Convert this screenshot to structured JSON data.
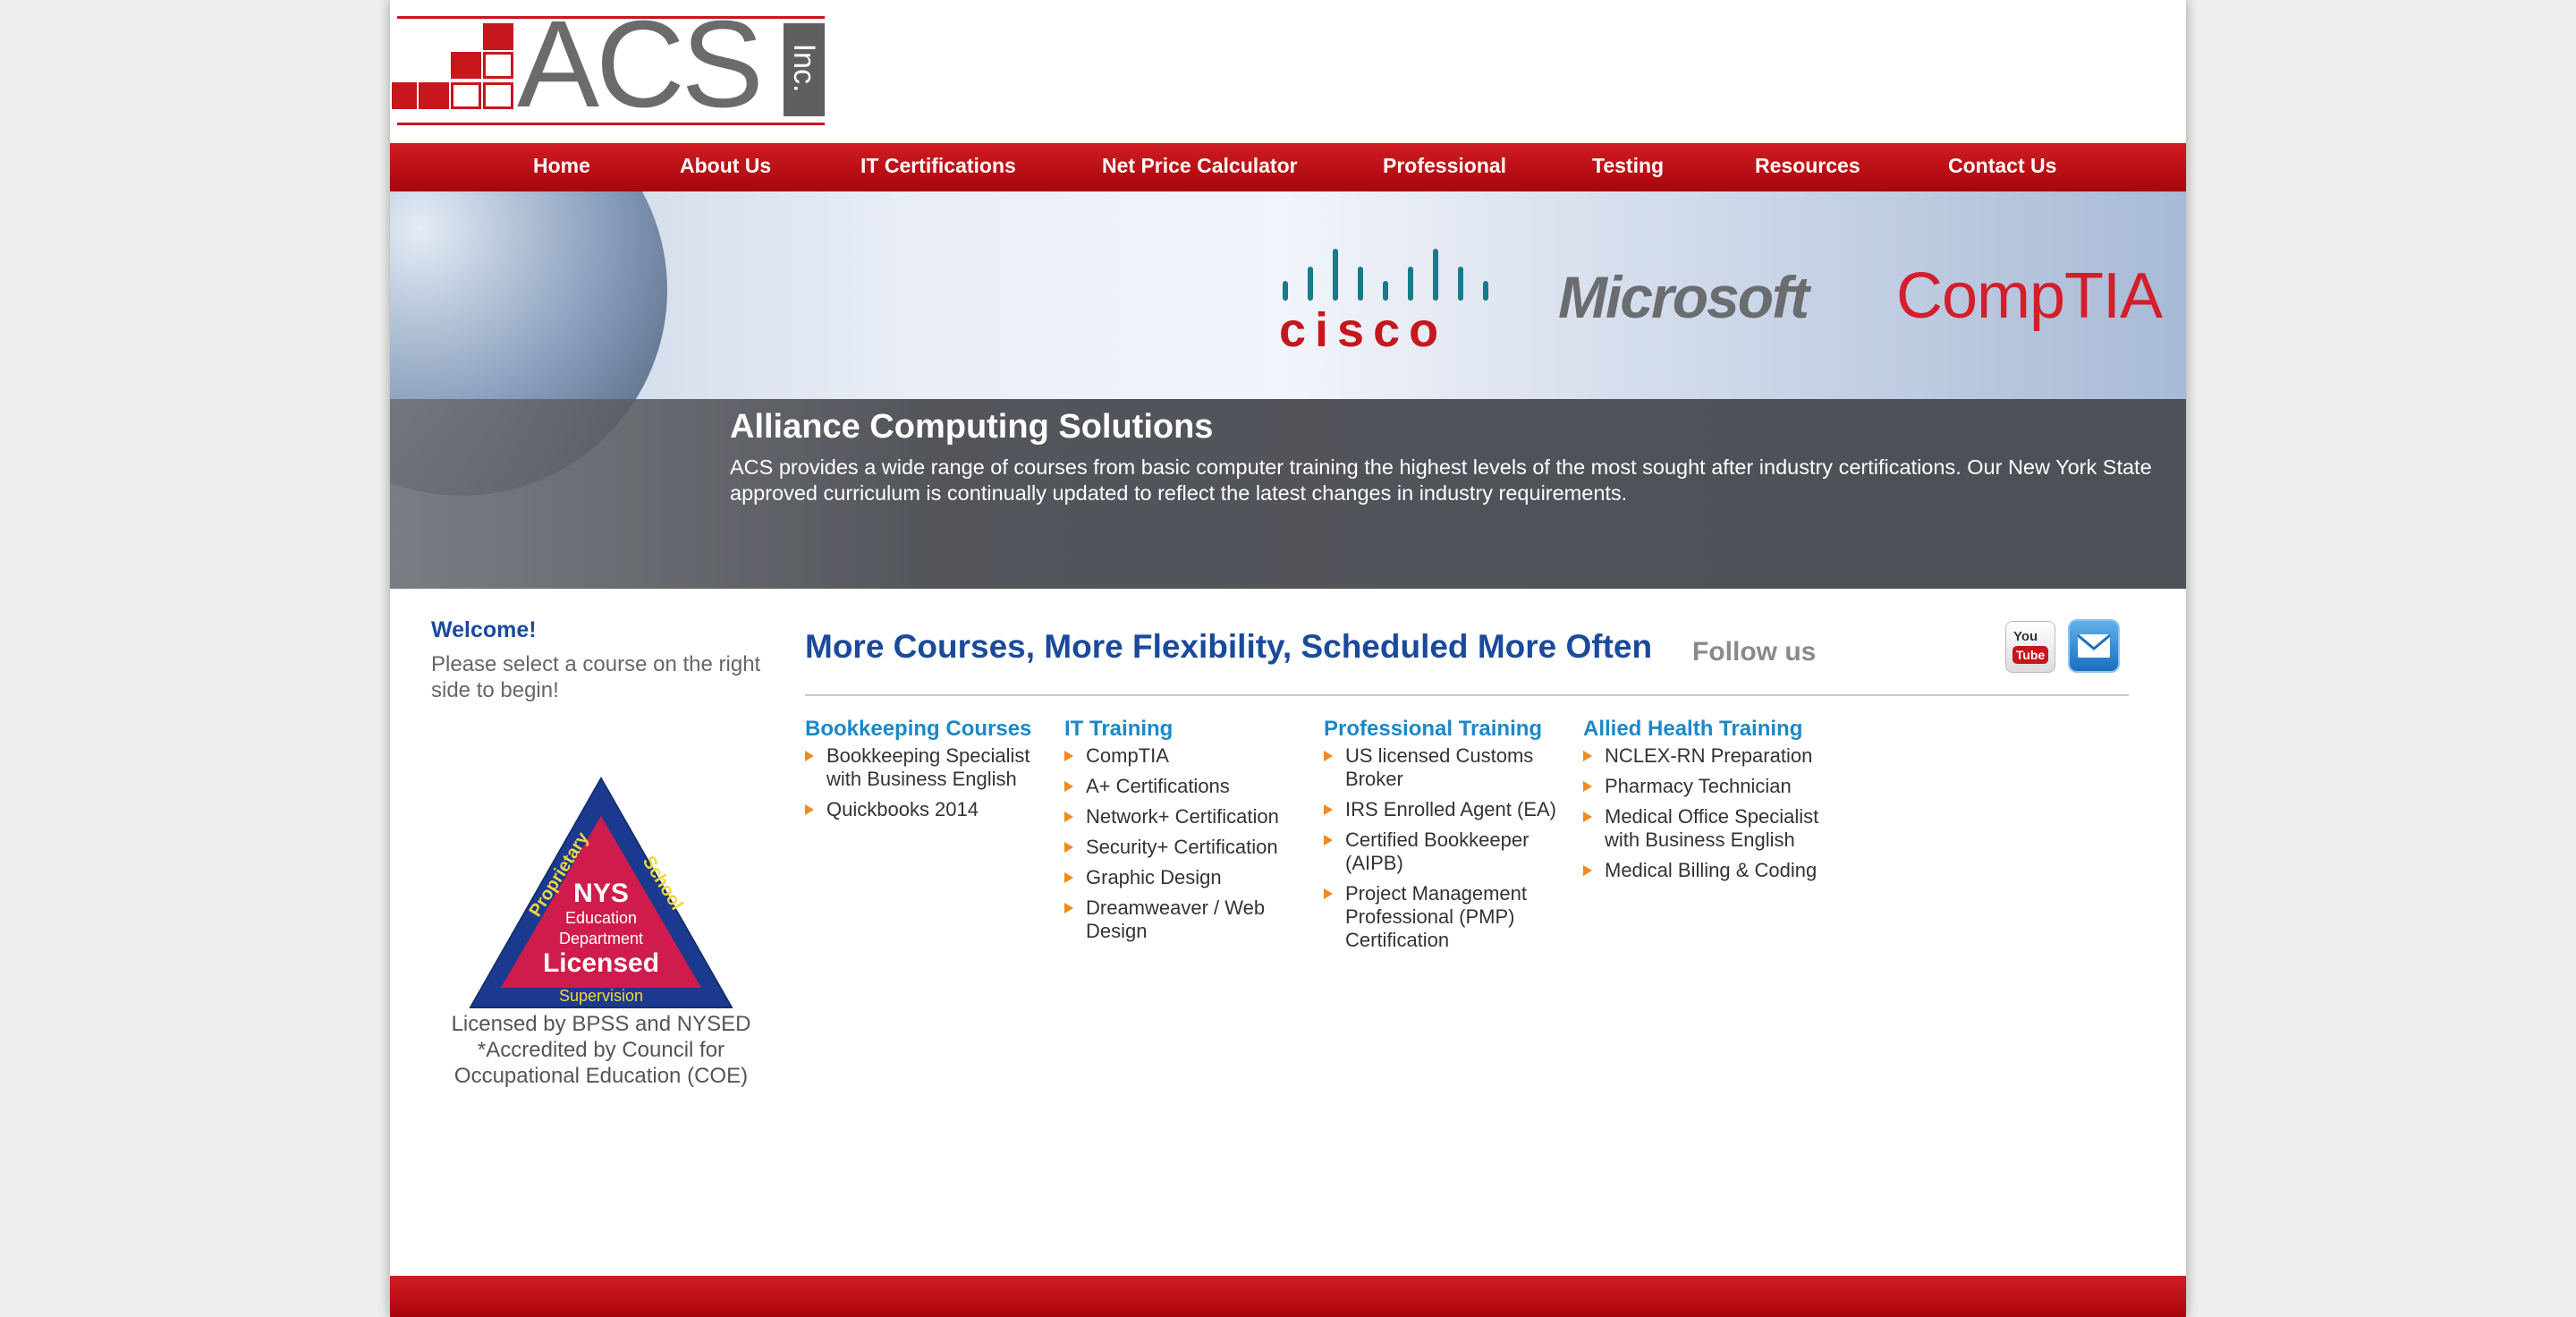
{
  "logo": {
    "text": "ACS",
    "suffix": "Inc."
  },
  "nav": [
    {
      "label": "Home"
    },
    {
      "label": "About Us"
    },
    {
      "label": "IT Certifications"
    },
    {
      "label": "Net Price Calculator"
    },
    {
      "label": "Professional"
    },
    {
      "label": "Testing"
    },
    {
      "label": "Resources"
    },
    {
      "label": "Contact Us"
    }
  ],
  "banner": {
    "partner_logos": {
      "cisco": "cisco",
      "microsoft": "Microsoft",
      "comptia": "CompTIA"
    },
    "title": "Alliance Computing Solutions",
    "text": "ACS provides a wide range of courses from basic computer training the highest levels of the most sought after industry certifications. Our New York State approved curriculum is continually updated to reflect the latest changes in industry requirements."
  },
  "sidebar": {
    "welcome_title": "Welcome!",
    "welcome_text": "Please select a course on the right side to begin!",
    "badge": {
      "arc_left": "Proprietary",
      "arc_right": "School",
      "line1": "NYS",
      "line2": "Education",
      "line3": "Department",
      "line4": "Licensed",
      "line5": "Supervision"
    },
    "badge_caption": "Licensed by BPSS and NYSED *Accredited by Council for Occupational Education (COE)"
  },
  "main": {
    "headline": "More Courses, More Flexibility, Scheduled More Often",
    "follow_label": "Follow us",
    "youtube_icon": {
      "you": "You",
      "tube": "Tube"
    },
    "columns": [
      {
        "title": "Bookkeeping Courses",
        "items": [
          "Bookkeeping Specialist with Business English",
          "Quickbooks 2014"
        ]
      },
      {
        "title": "IT Training",
        "items": [
          "CompTIA",
          "A+ Certifications",
          "Network+ Certification",
          "Security+ Certification",
          "Graphic Design",
          "Dreamweaver / Web Design"
        ]
      },
      {
        "title": "Professional Training",
        "items": [
          "US licensed Customs Broker",
          "IRS Enrolled Agent (EA)",
          "Certified Bookkeeper (AIPB)",
          "Project Management Professional (PMP) Certification"
        ]
      },
      {
        "title": "Allied Health Training",
        "items": [
          "NCLEX-RN Preparation",
          "Pharmacy Technician",
          "Medical Office Specialist with Business English",
          "Medical Billing & Coding"
        ]
      }
    ]
  },
  "colors": {
    "brand_red": "#c8161d",
    "link_blue": "#1c88c8",
    "heading_blue": "#1a4a9c",
    "bullet_orange": "#f08a1e"
  }
}
